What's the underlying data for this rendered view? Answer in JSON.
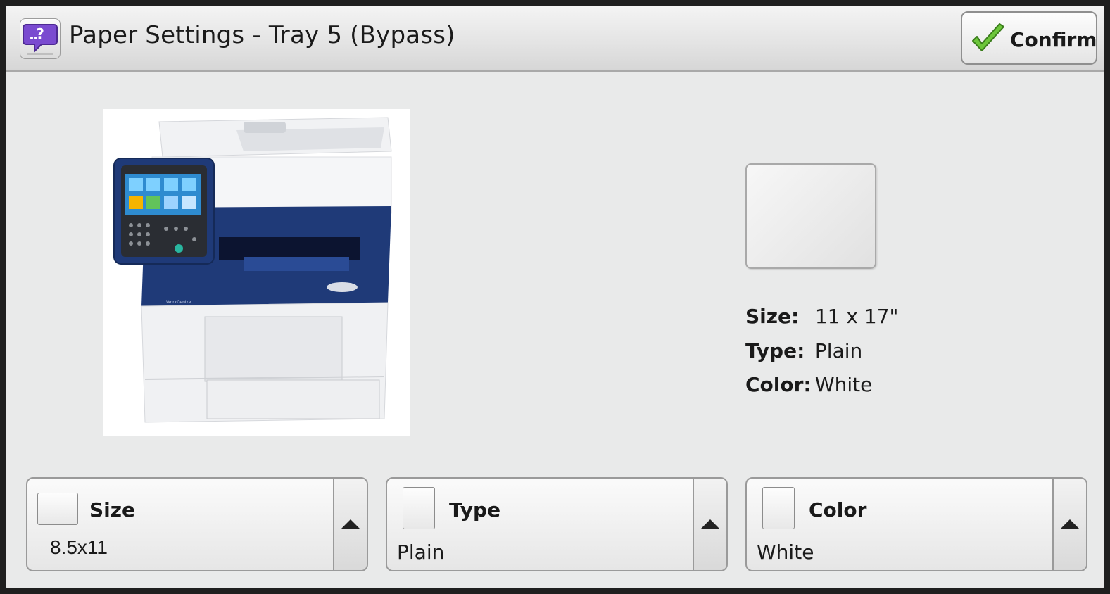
{
  "header": {
    "title": "Paper Settings - Tray 5 (Bypass)",
    "confirm_label": "Confirm",
    "help_icon": "help-speech-bubble-icon"
  },
  "current_paper": {
    "size_label": "Size:",
    "size_value": "11 x 17\"",
    "type_label": "Type:",
    "type_value": "Plain",
    "color_label": "Color:",
    "color_value": "White"
  },
  "selectors": [
    {
      "label": "Size",
      "value": "8.5x11"
    },
    {
      "label": "Type",
      "value": "Plain"
    },
    {
      "label": "Color",
      "value": "White"
    }
  ],
  "colors": {
    "accent_blue": "#1f3a78",
    "check_green": "#6cc63a",
    "help_purple": "#7a4bd0"
  }
}
